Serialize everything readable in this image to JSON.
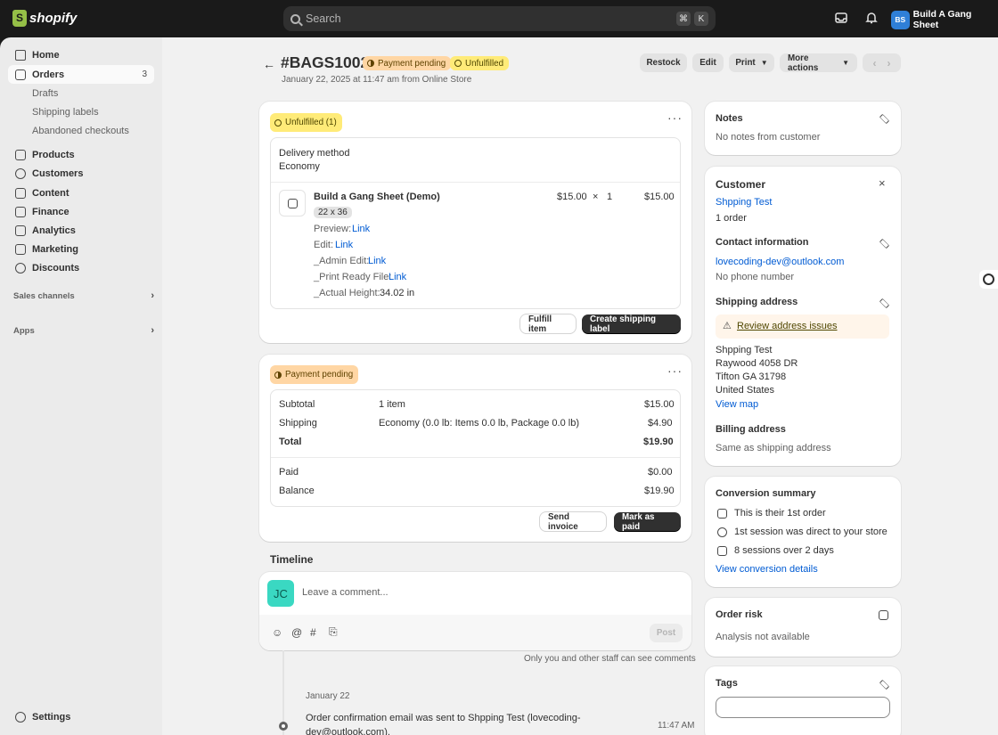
{
  "topbar": {
    "logo_text": "shopify",
    "search_placeholder": "Search",
    "shortcut_keys": [
      "⌘",
      "K"
    ],
    "store_initials": "BS",
    "store_name": "Build A Gang Sheet"
  },
  "sidebar": {
    "items": [
      {
        "label": "Home"
      },
      {
        "label": "Orders",
        "count": "3"
      },
      {
        "label": "Drafts"
      },
      {
        "label": "Shipping labels"
      },
      {
        "label": "Abandoned checkouts"
      },
      {
        "label": "Products"
      },
      {
        "label": "Customers"
      },
      {
        "label": "Content"
      },
      {
        "label": "Finance"
      },
      {
        "label": "Analytics"
      },
      {
        "label": "Marketing"
      },
      {
        "label": "Discounts"
      }
    ],
    "sales_channels": "Sales channels",
    "apps": "Apps",
    "settings": "Settings"
  },
  "header": {
    "order_number": "#BAGS1002",
    "payment_badge": "Payment pending",
    "fulfillment_badge": "Unfulfilled",
    "subtitle": "January 22, 2025 at 11:47 am from Online Store",
    "actions": {
      "restock": "Restock",
      "edit": "Edit",
      "print": "Print",
      "more": "More actions"
    }
  },
  "fulfillment_card": {
    "badge": "Unfulfilled (1)",
    "delivery_method_label": "Delivery method",
    "delivery_method_value": "Economy",
    "product_title": "Build a Gang Sheet (Demo)",
    "variant": "22 x 36",
    "unit_price": "$15.00",
    "times": "×",
    "quantity": "1",
    "line_total": "$15.00",
    "properties": [
      {
        "key": "Preview:",
        "value": "Link"
      },
      {
        "key": "Edit:",
        "value": "Link"
      },
      {
        "key": "_Admin Edit:",
        "value": "Link"
      },
      {
        "key": "_Print Ready File:",
        "value": "Link"
      },
      {
        "key": "_Actual Height:",
        "value": "34.02 in"
      }
    ],
    "fulfill_button": "Fulfill item",
    "label_button": "Create shipping label"
  },
  "payment_card": {
    "badge": "Payment pending",
    "subtotal_label": "Subtotal",
    "subtotal_desc": "1 item",
    "subtotal_value": "$15.00",
    "shipping_label": "Shipping",
    "shipping_desc": "Economy (0.0 lb: Items 0.0 lb, Package 0.0 lb)",
    "shipping_value": "$4.90",
    "total_label": "Total",
    "total_value": "$19.90",
    "paid_label": "Paid",
    "paid_value": "$0.00",
    "balance_label": "Balance",
    "balance_value": "$19.90",
    "send_invoice": "Send invoice",
    "mark_paid": "Mark as paid"
  },
  "timeline": {
    "title": "Timeline",
    "avatar_initials": "JC",
    "comment_placeholder": "Leave a comment...",
    "post_button": "Post",
    "visibility_note": "Only you and other staff can see comments",
    "date": "January 22",
    "event_text_line1": "Order confirmation email was sent to Shpping Test (lovecoding-",
    "event_text_line2": "dev@outlook.com).",
    "event_time": "11:47 AM"
  },
  "right": {
    "notes_title": "Notes",
    "notes_text": "No notes from customer",
    "customer_title": "Customer",
    "customer_name": "Shpping Test",
    "customer_orders": "1 order",
    "contact_title": "Contact information",
    "contact_email": "lovecoding-dev@outlook.com",
    "contact_phone": "No phone number",
    "shipping_title": "Shipping address",
    "review_issues": "Review address issues",
    "address_lines": [
      "Shpping Test",
      "Raywood 4058 DR",
      "Tifton GA 31798",
      "United States"
    ],
    "view_map": "View map",
    "billing_title": "Billing address",
    "billing_text": "Same as shipping address",
    "conversion_title": "Conversion summary",
    "conversion_items": [
      "This is their 1st order",
      "1st session was direct to your store",
      "8 sessions over 2 days"
    ],
    "conversion_link": "View conversion details",
    "risk_title": "Order risk",
    "risk_text": "Analysis not available",
    "tags_title": "Tags",
    "tags_value": ""
  },
  "colors": {
    "accent": "#005bd3",
    "orange_badge": "#ffd6a4",
    "yellow_badge": "#ffeb78",
    "topbar": "#1a1a1a"
  }
}
